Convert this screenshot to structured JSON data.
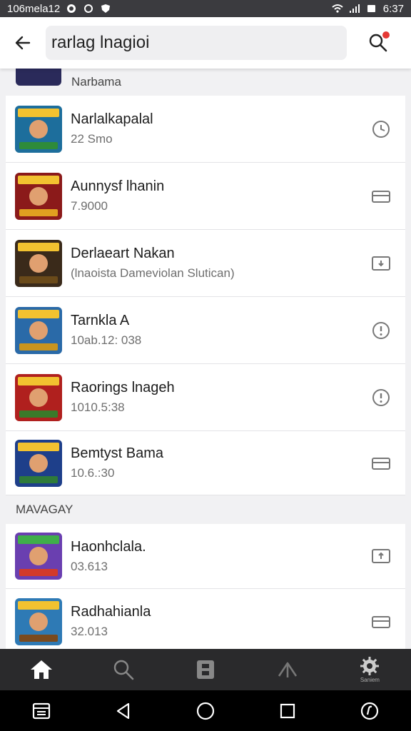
{
  "status_bar": {
    "left_text": "106mela12",
    "time": "6:37"
  },
  "search": {
    "value": "rarlag lnagioi"
  },
  "groups": [
    {
      "header": "Narbama",
      "items": [
        {
          "title": "Narlalkapalal",
          "subtitle": "22 Smo",
          "action_icon": "clock-icon"
        },
        {
          "title": "Aunnysf lhanin",
          "subtitle": "7.9000",
          "action_icon": "card-icon"
        },
        {
          "title": "Derlaeart Nakan",
          "subtitle": "(lnaoista Dameviolan Slutican)",
          "action_icon": "download-icon"
        },
        {
          "title": "Tarnkla A",
          "subtitle": "10ab.12: 038",
          "action_icon": "info-icon"
        },
        {
          "title": "Raorings lnageh",
          "subtitle": "1010.5:38",
          "action_icon": "info-icon"
        },
        {
          "title": "Bemtyst Bama",
          "subtitle": "10.6.:30",
          "action_icon": "card-icon"
        }
      ]
    },
    {
      "header": "MAVAGAY",
      "items": [
        {
          "title": "Haonhclala.",
          "subtitle": "03.613",
          "action_icon": "upload-icon"
        },
        {
          "title": "Radhahianla",
          "subtitle": "32.013",
          "action_icon": "card-icon"
        }
      ]
    }
  ],
  "thumb_colors": [
    "#1d6e9c",
    "#8b1a1a",
    "#3a2a1a",
    "#2a6aa8",
    "#b0201e",
    "#1e3f8a",
    "#6a3fb0",
    "#2e7ab5"
  ],
  "bottom_nav": [
    {
      "icon": "home-icon",
      "label": ""
    },
    {
      "icon": "search-icon",
      "label": ""
    },
    {
      "icon": "library-icon",
      "label": ""
    },
    {
      "icon": "share-icon",
      "label": ""
    },
    {
      "icon": "settings-icon",
      "label": "Saniem"
    }
  ],
  "system_nav": [
    "menu-icon",
    "back-icon",
    "home-circle-icon",
    "recents-icon",
    "assist-icon"
  ],
  "colors": {
    "accent_red": "#e53935",
    "nav_bg": "#2a2a2c",
    "status_bg": "#3b3b3f"
  }
}
